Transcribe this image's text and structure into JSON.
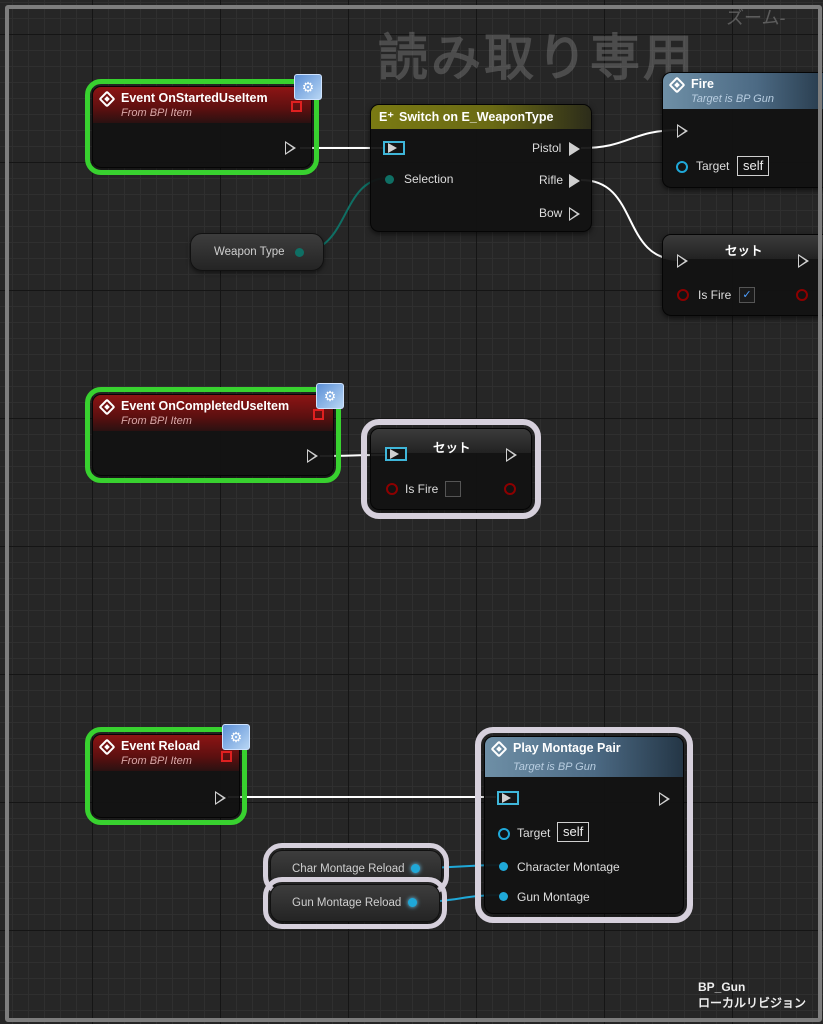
{
  "watermark": "読み取り専用",
  "zoom_label": "ズーム-",
  "blueprint": {
    "name": "BP_Gun",
    "revision": "ローカルリビジョン"
  },
  "nodes": {
    "event_started": {
      "title": "Event OnStartedUseItem",
      "subtitle": "From BPI Item"
    },
    "switch": {
      "title": "Switch on E_WeaponType",
      "selection_label": "Selection",
      "pistol": "Pistol",
      "rifle": "Rifle",
      "bow": "Bow"
    },
    "weapon_type_var": {
      "label": "Weapon Type"
    },
    "fire": {
      "title": "Fire",
      "subtitle": "Target is BP Gun",
      "target_label": "Target",
      "target_value": "self"
    },
    "set_top": {
      "title": "セット",
      "pin_label": "Is Fire",
      "checked_mark": "✓"
    },
    "event_completed": {
      "title": "Event OnCompletedUseItem",
      "subtitle": "From BPI Item"
    },
    "set_mid": {
      "title": "セット",
      "pin_label": "Is Fire"
    },
    "event_reload": {
      "title": "Event Reload",
      "subtitle": "From BPI Item"
    },
    "play_montage": {
      "title": "Play Montage Pair",
      "subtitle": "Target is BP Gun",
      "target_label": "Target",
      "target_value": "self",
      "char_label": "Character Montage",
      "gun_label": "Gun Montage"
    },
    "char_montage_var": {
      "label": "Char Montage Reload"
    },
    "gun_montage_var": {
      "label": "Gun Montage Reload"
    }
  },
  "colors": {
    "exec_wire": "#ffffff",
    "object_wire": "#1fa8d8",
    "enum_wire": "#0f6f64",
    "bool_pin": "#8c0000",
    "selection_green": "#38d12f",
    "selection_white": "#d6d0dc"
  }
}
